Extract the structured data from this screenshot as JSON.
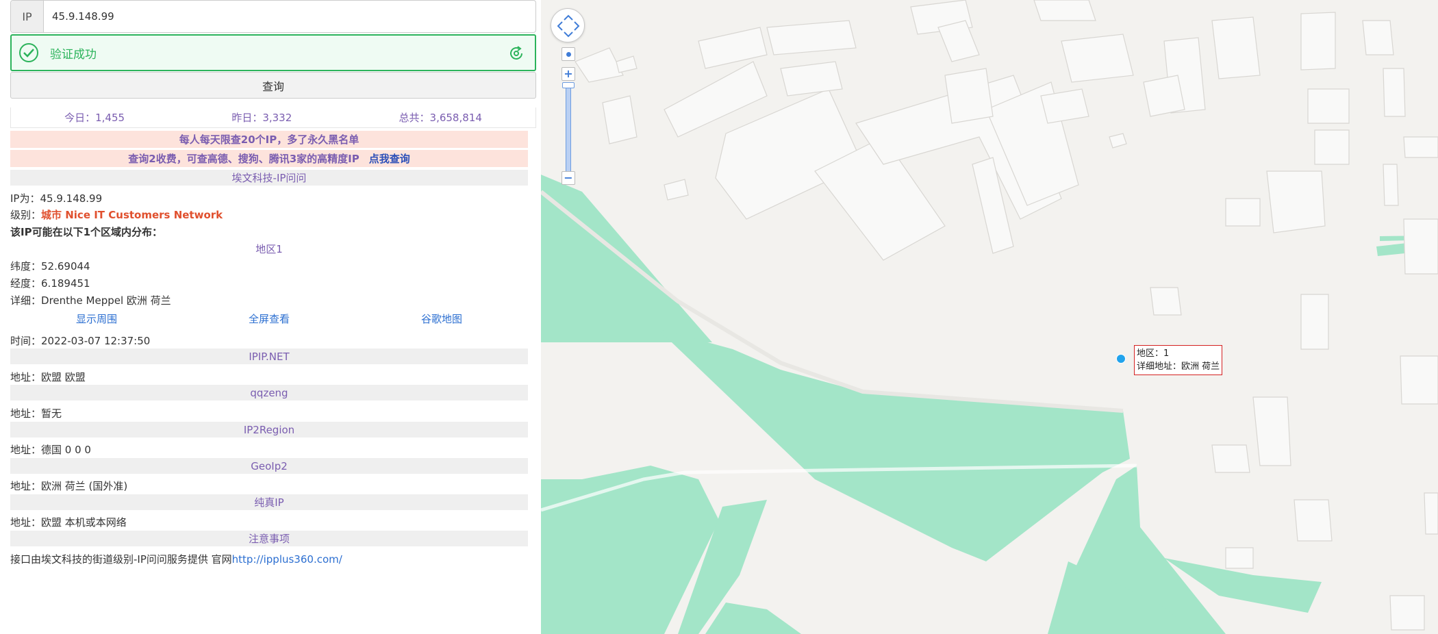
{
  "ip_input": {
    "label": "IP",
    "value": "45.9.148.99"
  },
  "verify": {
    "text": "验证成功",
    "color": "#2cb35b"
  },
  "query_button": "查询",
  "stats": {
    "today": "今日：1,455",
    "yesterday": "昨日：3,332",
    "total": "总共：3,658,814"
  },
  "banners": {
    "limit": "每人每天限查20个IP，多了永久黑名单",
    "paid": "查询2收费，可查高德、搜狗、腾讯3家的高精度IP",
    "paid_link": "点我查询"
  },
  "result": {
    "provider_title": "埃文科技-IP问问",
    "ip_line_label": "IP为：",
    "ip_line_value": "45.9.148.99",
    "level_label": "级别：",
    "level_value": "城市 Nice IT Customers Network",
    "distribution": "该IP可能在以下1个区域内分布：",
    "region_title": "地区1",
    "lat_label": "纬度：",
    "lat_value": "52.69044",
    "lng_label": "经度：",
    "lng_value": "6.189451",
    "detail_label": "详细：",
    "detail_value": "Drenthe Meppel 欧洲 荷兰",
    "links": [
      "显示周围",
      "全屏查看",
      "谷歌地图"
    ],
    "time_label": "时间：",
    "time_value": "2022-03-07 12:37:50"
  },
  "sources": [
    {
      "title": "IPIP.NET",
      "label": "地址：",
      "value": "欧盟 欧盟"
    },
    {
      "title": "qqzeng",
      "label": "地址：",
      "value": "暂无"
    },
    {
      "title": "IP2Region",
      "label": "地址：",
      "value": "德国 0 0 0"
    },
    {
      "title": "GeoIp2",
      "label": "地址：",
      "value": "欧洲 荷兰 (国外准)"
    },
    {
      "title": "纯真IP",
      "label": "地址：",
      "value": "欧盟 本机或本网络"
    }
  ],
  "notice_title": "注意事项",
  "footer": {
    "text": "接口由埃文科技的街道级别-IP问问服务提供 官网",
    "link": "http://ipplus360.com/"
  },
  "map": {
    "info_region": "地区：1",
    "info_detail": "详细地址：欧洲 荷兰",
    "colors": {
      "background": "#f3f2ef",
      "green": "#a3e5c8",
      "building": "#f9f9f8",
      "marker": "#21a3ec",
      "info_border": "#d42020"
    }
  }
}
